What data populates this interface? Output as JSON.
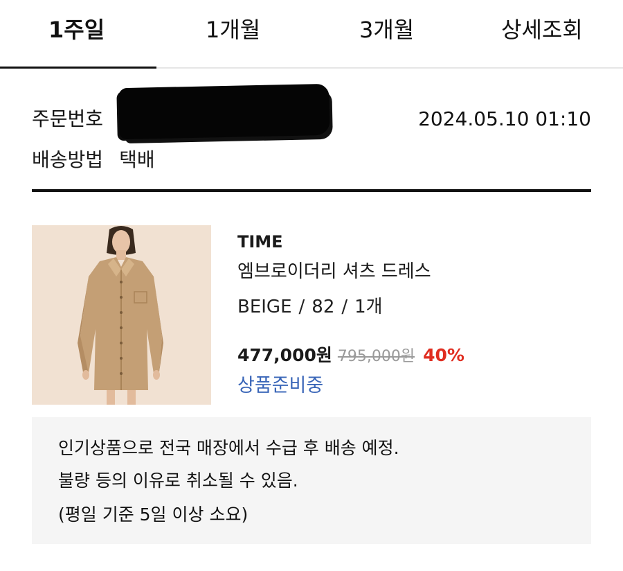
{
  "tabs": [
    {
      "label": "1주일",
      "active": true
    },
    {
      "label": "1개월",
      "active": false
    },
    {
      "label": "3개월",
      "active": false
    },
    {
      "label": "상세조회",
      "active": false
    }
  ],
  "order": {
    "number_label": "주문번호",
    "date": "2024.05.10 01:10",
    "shipping_label": "배송방법",
    "shipping_value": "택배"
  },
  "product": {
    "brand": "TIME",
    "name": "엠브로이더리 셔츠 드레스",
    "color": "BEIGE",
    "size": "82",
    "quantity": "1개",
    "option_separator": "/",
    "price": "477,000원",
    "original_price": "795,000원",
    "discount": "40%",
    "status": "상품준비중"
  },
  "notice": {
    "lines": [
      "인기상품으로 전국 매장에서 수급 후 배송 예정.",
      "불량 등의 이유로 취소될 수 있음.",
      "(평일 기준 5일 이상 소요)"
    ]
  },
  "colors": {
    "status": "#3a66b8",
    "discount": "#e02d20",
    "notice_bg": "#f5f5f5",
    "thumb_bg": "#f1e1d2"
  }
}
